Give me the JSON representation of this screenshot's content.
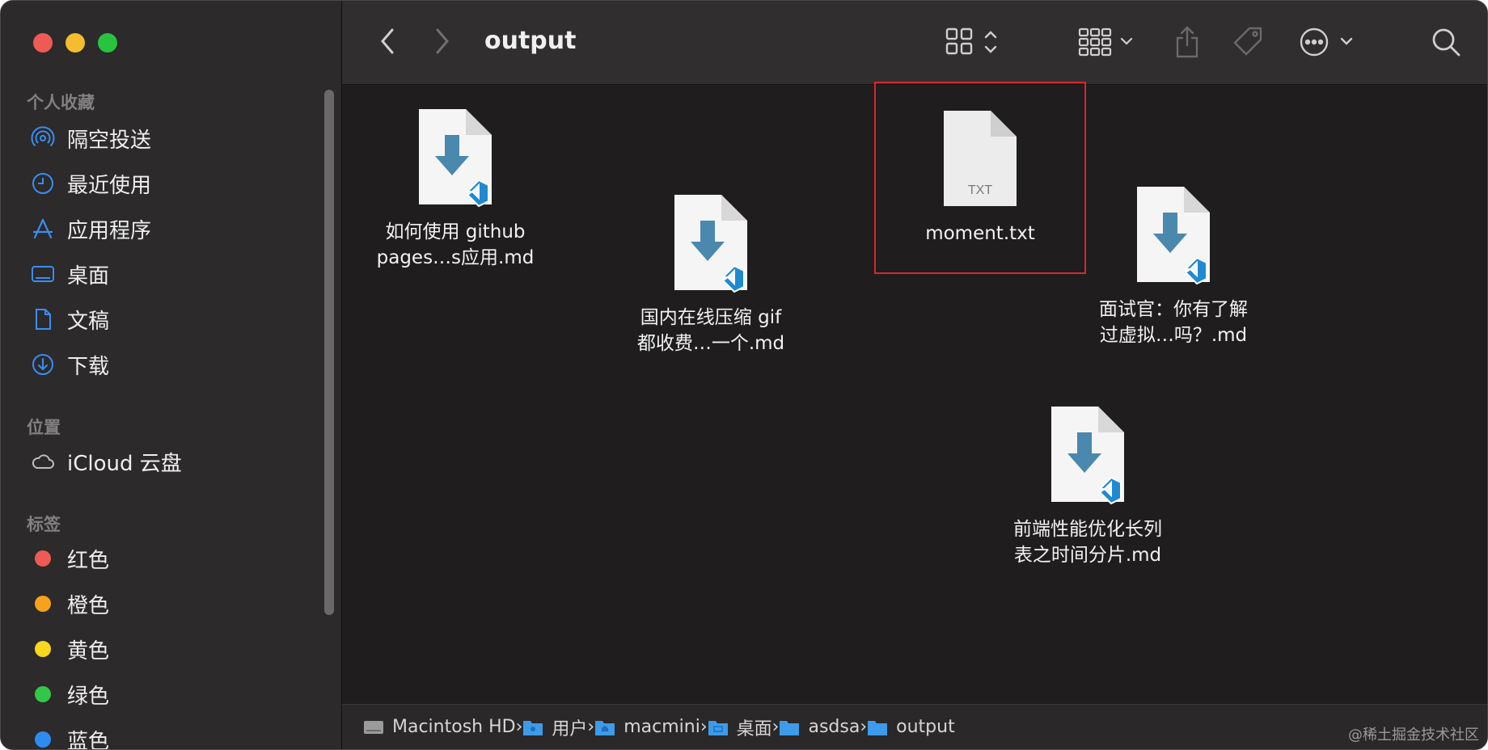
{
  "window": {
    "title": "output"
  },
  "sidebar": {
    "favorites_label": "个人收藏",
    "favorites": [
      {
        "label": "隔空投送",
        "icon": "airdrop-icon"
      },
      {
        "label": "最近使用",
        "icon": "clock-icon"
      },
      {
        "label": "应用程序",
        "icon": "applications-icon"
      },
      {
        "label": "桌面",
        "icon": "desktop-icon"
      },
      {
        "label": "文稿",
        "icon": "document-icon"
      },
      {
        "label": "下载",
        "icon": "download-icon"
      }
    ],
    "locations_label": "位置",
    "locations": [
      {
        "label": "iCloud 云盘",
        "icon": "cloud-icon"
      }
    ],
    "tags_label": "标签",
    "tags": [
      {
        "label": "红色",
        "color": "#ee5b55"
      },
      {
        "label": "橙色",
        "color": "#f7a21c"
      },
      {
        "label": "黄色",
        "color": "#f8d71c"
      },
      {
        "label": "绿色",
        "color": "#33c748"
      },
      {
        "label": "蓝色",
        "color": "#2d8cf0"
      }
    ]
  },
  "files": [
    {
      "line1": "如何使用 github",
      "line2": "pages…s应用.md",
      "type": "md"
    },
    {
      "line1": "国内在线压缩 gif",
      "line2": "都收费…一个.md",
      "type": "md"
    },
    {
      "line1": "moment.txt",
      "line2": "",
      "type": "txt",
      "badge": "TXT",
      "selected": true
    },
    {
      "line1": "面试官：你有了解",
      "line2": "过虚拟…吗？.md",
      "type": "md"
    },
    {
      "line1": "前端性能优化长列",
      "line2": "表之时间分片.md",
      "type": "md"
    }
  ],
  "path": [
    {
      "label": "Macintosh HD",
      "icon": "drive-icon"
    },
    {
      "label": "用户",
      "icon": "users-folder-icon"
    },
    {
      "label": "macmini",
      "icon": "home-folder-icon"
    },
    {
      "label": "桌面",
      "icon": "desktop-folder-icon"
    },
    {
      "label": "asdsa",
      "icon": "folder-icon"
    },
    {
      "label": "output",
      "icon": "folder-icon"
    }
  ],
  "watermark": "@稀土掘金技术社区",
  "colors": {
    "accent": "#2d8cf0",
    "selection": "#d9262c"
  }
}
